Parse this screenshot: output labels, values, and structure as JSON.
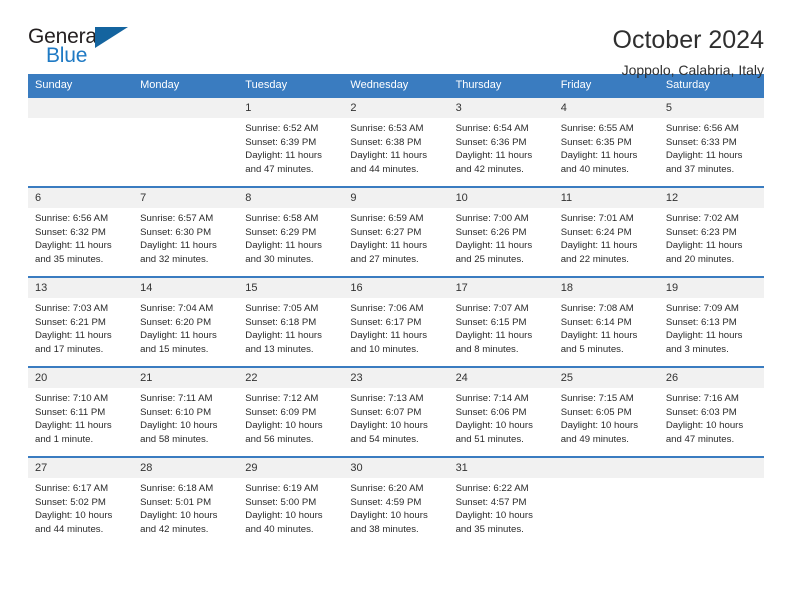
{
  "brand": {
    "name_top": "General",
    "name_bottom": "Blue",
    "accent_color": "#1f7ac4",
    "triangle_color": "#14649f",
    "triangle_icon": "triangle-right-icon"
  },
  "header": {
    "title": "October 2024",
    "subtitle": "Joppolo, Calabria, Italy"
  },
  "calendar": {
    "header_bg": "#3a7cc0",
    "daynum_bg": "#f1f1f1",
    "weekday_headers": [
      "Sunday",
      "Monday",
      "Tuesday",
      "Wednesday",
      "Thursday",
      "Friday",
      "Saturday"
    ],
    "weeks": [
      [
        {
          "day": "",
          "sunrise": "",
          "sunset": "",
          "daylight_line1": "",
          "daylight_line2": ""
        },
        {
          "day": "",
          "sunrise": "",
          "sunset": "",
          "daylight_line1": "",
          "daylight_line2": ""
        },
        {
          "day": "1",
          "sunrise": "Sunrise: 6:52 AM",
          "sunset": "Sunset: 6:39 PM",
          "daylight_line1": "Daylight: 11 hours",
          "daylight_line2": "and 47 minutes."
        },
        {
          "day": "2",
          "sunrise": "Sunrise: 6:53 AM",
          "sunset": "Sunset: 6:38 PM",
          "daylight_line1": "Daylight: 11 hours",
          "daylight_line2": "and 44 minutes."
        },
        {
          "day": "3",
          "sunrise": "Sunrise: 6:54 AM",
          "sunset": "Sunset: 6:36 PM",
          "daylight_line1": "Daylight: 11 hours",
          "daylight_line2": "and 42 minutes."
        },
        {
          "day": "4",
          "sunrise": "Sunrise: 6:55 AM",
          "sunset": "Sunset: 6:35 PM",
          "daylight_line1": "Daylight: 11 hours",
          "daylight_line2": "and 40 minutes."
        },
        {
          "day": "5",
          "sunrise": "Sunrise: 6:56 AM",
          "sunset": "Sunset: 6:33 PM",
          "daylight_line1": "Daylight: 11 hours",
          "daylight_line2": "and 37 minutes."
        }
      ],
      [
        {
          "day": "6",
          "sunrise": "Sunrise: 6:56 AM",
          "sunset": "Sunset: 6:32 PM",
          "daylight_line1": "Daylight: 11 hours",
          "daylight_line2": "and 35 minutes."
        },
        {
          "day": "7",
          "sunrise": "Sunrise: 6:57 AM",
          "sunset": "Sunset: 6:30 PM",
          "daylight_line1": "Daylight: 11 hours",
          "daylight_line2": "and 32 minutes."
        },
        {
          "day": "8",
          "sunrise": "Sunrise: 6:58 AM",
          "sunset": "Sunset: 6:29 PM",
          "daylight_line1": "Daylight: 11 hours",
          "daylight_line2": "and 30 minutes."
        },
        {
          "day": "9",
          "sunrise": "Sunrise: 6:59 AM",
          "sunset": "Sunset: 6:27 PM",
          "daylight_line1": "Daylight: 11 hours",
          "daylight_line2": "and 27 minutes."
        },
        {
          "day": "10",
          "sunrise": "Sunrise: 7:00 AM",
          "sunset": "Sunset: 6:26 PM",
          "daylight_line1": "Daylight: 11 hours",
          "daylight_line2": "and 25 minutes."
        },
        {
          "day": "11",
          "sunrise": "Sunrise: 7:01 AM",
          "sunset": "Sunset: 6:24 PM",
          "daylight_line1": "Daylight: 11 hours",
          "daylight_line2": "and 22 minutes."
        },
        {
          "day": "12",
          "sunrise": "Sunrise: 7:02 AM",
          "sunset": "Sunset: 6:23 PM",
          "daylight_line1": "Daylight: 11 hours",
          "daylight_line2": "and 20 minutes."
        }
      ],
      [
        {
          "day": "13",
          "sunrise": "Sunrise: 7:03 AM",
          "sunset": "Sunset: 6:21 PM",
          "daylight_line1": "Daylight: 11 hours",
          "daylight_line2": "and 17 minutes."
        },
        {
          "day": "14",
          "sunrise": "Sunrise: 7:04 AM",
          "sunset": "Sunset: 6:20 PM",
          "daylight_line1": "Daylight: 11 hours",
          "daylight_line2": "and 15 minutes."
        },
        {
          "day": "15",
          "sunrise": "Sunrise: 7:05 AM",
          "sunset": "Sunset: 6:18 PM",
          "daylight_line1": "Daylight: 11 hours",
          "daylight_line2": "and 13 minutes."
        },
        {
          "day": "16",
          "sunrise": "Sunrise: 7:06 AM",
          "sunset": "Sunset: 6:17 PM",
          "daylight_line1": "Daylight: 11 hours",
          "daylight_line2": "and 10 minutes."
        },
        {
          "day": "17",
          "sunrise": "Sunrise: 7:07 AM",
          "sunset": "Sunset: 6:15 PM",
          "daylight_line1": "Daylight: 11 hours",
          "daylight_line2": "and 8 minutes."
        },
        {
          "day": "18",
          "sunrise": "Sunrise: 7:08 AM",
          "sunset": "Sunset: 6:14 PM",
          "daylight_line1": "Daylight: 11 hours",
          "daylight_line2": "and 5 minutes."
        },
        {
          "day": "19",
          "sunrise": "Sunrise: 7:09 AM",
          "sunset": "Sunset: 6:13 PM",
          "daylight_line1": "Daylight: 11 hours",
          "daylight_line2": "and 3 minutes."
        }
      ],
      [
        {
          "day": "20",
          "sunrise": "Sunrise: 7:10 AM",
          "sunset": "Sunset: 6:11 PM",
          "daylight_line1": "Daylight: 11 hours",
          "daylight_line2": "and 1 minute."
        },
        {
          "day": "21",
          "sunrise": "Sunrise: 7:11 AM",
          "sunset": "Sunset: 6:10 PM",
          "daylight_line1": "Daylight: 10 hours",
          "daylight_line2": "and 58 minutes."
        },
        {
          "day": "22",
          "sunrise": "Sunrise: 7:12 AM",
          "sunset": "Sunset: 6:09 PM",
          "daylight_line1": "Daylight: 10 hours",
          "daylight_line2": "and 56 minutes."
        },
        {
          "day": "23",
          "sunrise": "Sunrise: 7:13 AM",
          "sunset": "Sunset: 6:07 PM",
          "daylight_line1": "Daylight: 10 hours",
          "daylight_line2": "and 54 minutes."
        },
        {
          "day": "24",
          "sunrise": "Sunrise: 7:14 AM",
          "sunset": "Sunset: 6:06 PM",
          "daylight_line1": "Daylight: 10 hours",
          "daylight_line2": "and 51 minutes."
        },
        {
          "day": "25",
          "sunrise": "Sunrise: 7:15 AM",
          "sunset": "Sunset: 6:05 PM",
          "daylight_line1": "Daylight: 10 hours",
          "daylight_line2": "and 49 minutes."
        },
        {
          "day": "26",
          "sunrise": "Sunrise: 7:16 AM",
          "sunset": "Sunset: 6:03 PM",
          "daylight_line1": "Daylight: 10 hours",
          "daylight_line2": "and 47 minutes."
        }
      ],
      [
        {
          "day": "27",
          "sunrise": "Sunrise: 6:17 AM",
          "sunset": "Sunset: 5:02 PM",
          "daylight_line1": "Daylight: 10 hours",
          "daylight_line2": "and 44 minutes."
        },
        {
          "day": "28",
          "sunrise": "Sunrise: 6:18 AM",
          "sunset": "Sunset: 5:01 PM",
          "daylight_line1": "Daylight: 10 hours",
          "daylight_line2": "and 42 minutes."
        },
        {
          "day": "29",
          "sunrise": "Sunrise: 6:19 AM",
          "sunset": "Sunset: 5:00 PM",
          "daylight_line1": "Daylight: 10 hours",
          "daylight_line2": "and 40 minutes."
        },
        {
          "day": "30",
          "sunrise": "Sunrise: 6:20 AM",
          "sunset": "Sunset: 4:59 PM",
          "daylight_line1": "Daylight: 10 hours",
          "daylight_line2": "and 38 minutes."
        },
        {
          "day": "31",
          "sunrise": "Sunrise: 6:22 AM",
          "sunset": "Sunset: 4:57 PM",
          "daylight_line1": "Daylight: 10 hours",
          "daylight_line2": "and 35 minutes."
        },
        {
          "day": "",
          "sunrise": "",
          "sunset": "",
          "daylight_line1": "",
          "daylight_line2": ""
        },
        {
          "day": "",
          "sunrise": "",
          "sunset": "",
          "daylight_line1": "",
          "daylight_line2": ""
        }
      ]
    ]
  }
}
